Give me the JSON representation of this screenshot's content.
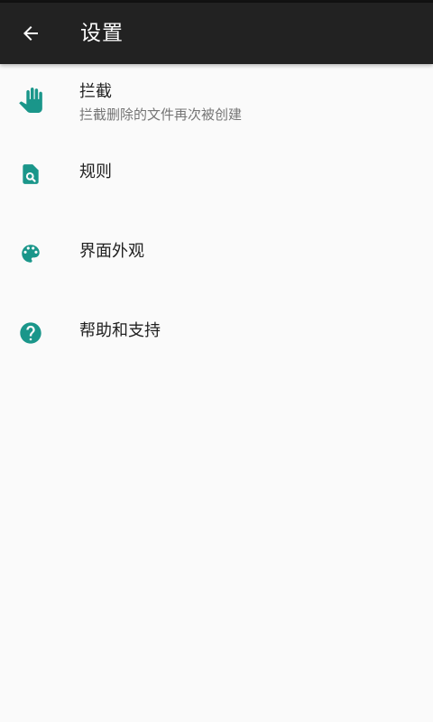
{
  "toolbar": {
    "title": "设置",
    "back_icon": "arrow-back-icon",
    "background_color": "#222222"
  },
  "accent_color": "#1a968a",
  "settings_items": [
    {
      "title": "拦截",
      "subtitle": "拦截删除的文件再次被创建",
      "icon": "hand-icon"
    },
    {
      "title": "规则",
      "icon": "file-search-icon"
    },
    {
      "title": "界面外观",
      "icon": "palette-icon"
    },
    {
      "title": "帮助和支持",
      "icon": "help-circle-icon"
    }
  ]
}
